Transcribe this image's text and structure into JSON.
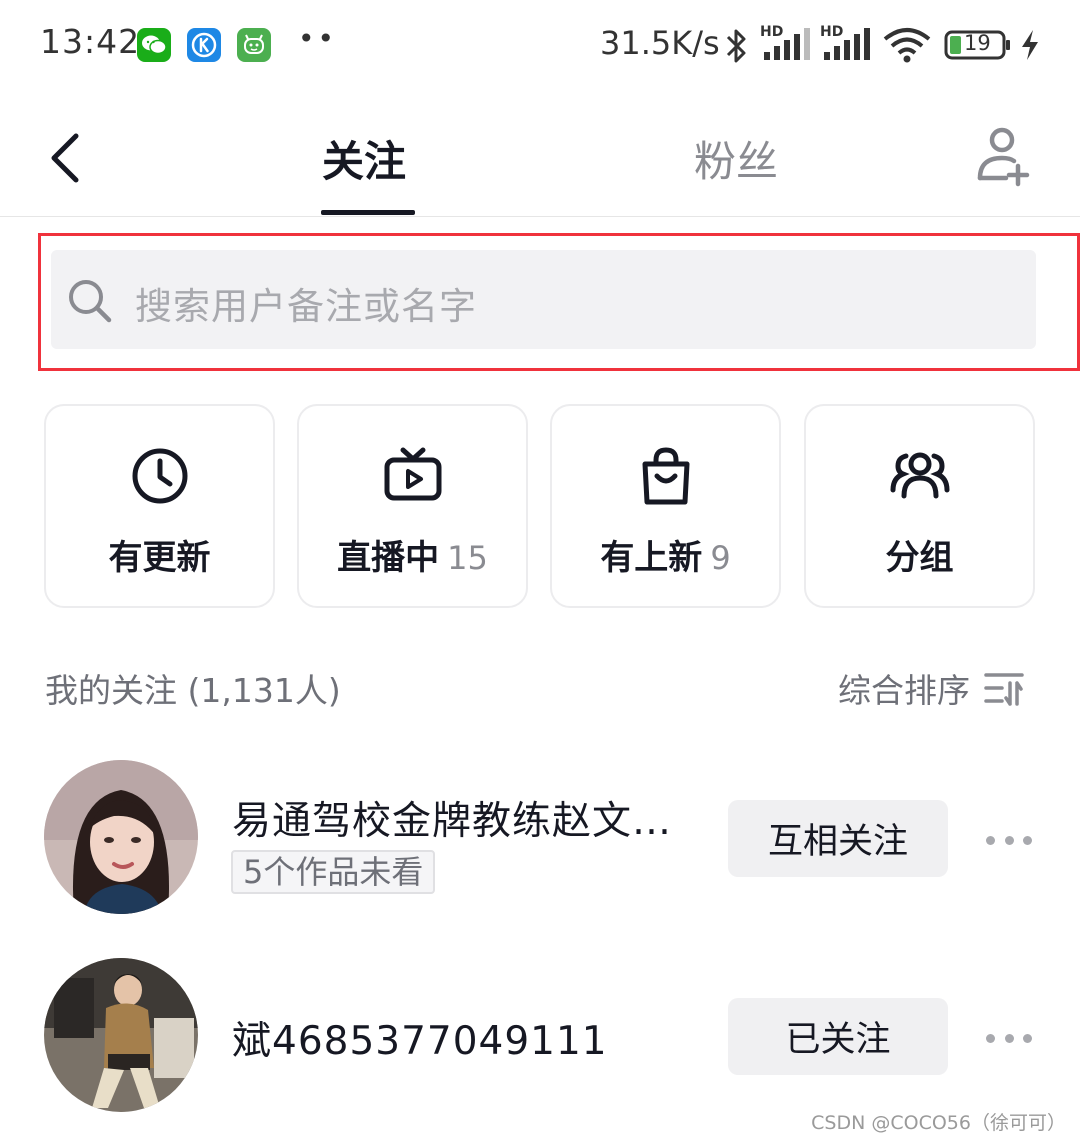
{
  "status_bar": {
    "time": "13:42",
    "app_icons": [
      {
        "name": "wechat-icon",
        "color": "#1aad19"
      },
      {
        "name": "k-app-icon",
        "color": "#1e88e5",
        "glyph": "K"
      },
      {
        "name": "robot-app-icon",
        "color": "#4caf50"
      }
    ],
    "dots": "••",
    "net_speed": "31.5K/s",
    "signal_label": "HD",
    "battery": "19",
    "battery_color": "#4caf50"
  },
  "header": {
    "tab_following": "关注",
    "tab_fans": "粉丝"
  },
  "search": {
    "placeholder": "搜索用户备注或名字",
    "highlight_color": "#f0323c"
  },
  "quick_cards": [
    {
      "icon": "clock-icon",
      "label": "有更新",
      "count": ""
    },
    {
      "icon": "tv-play-icon",
      "label": "直播中",
      "count": "15"
    },
    {
      "icon": "shopping-bag-icon",
      "label": "有上新",
      "count": "9"
    },
    {
      "icon": "group-icon",
      "label": "分组",
      "count": ""
    }
  ],
  "section": {
    "title": "我的关注 (1,131人)",
    "sort_label": "综合排序"
  },
  "users": [
    {
      "name": "易通驾校金牌教练赵文…",
      "badge": "5个作品未看",
      "button": "互相关注"
    },
    {
      "name": "斌4685377049111",
      "badge": "",
      "button": "已关注"
    }
  ],
  "watermark": "CSDN @COCO56（徐可可）"
}
